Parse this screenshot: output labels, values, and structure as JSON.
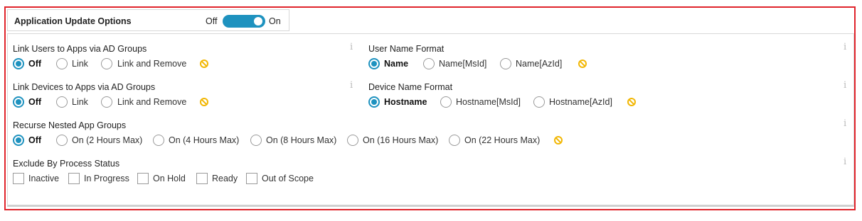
{
  "header": {
    "title": "Application Update Options",
    "toggle_off_label": "Off",
    "toggle_on_label": "On",
    "toggle_state": "on"
  },
  "sections": {
    "link_users": {
      "title": "Link Users to Apps via AD Groups",
      "options": [
        "Off",
        "Link",
        "Link and Remove"
      ],
      "selected": "Off"
    },
    "user_name_format": {
      "title": "User Name Format",
      "options": [
        "Name",
        "Name[MsId]",
        "Name[AzId]"
      ],
      "selected": "Name"
    },
    "link_devices": {
      "title": "Link Devices to Apps via AD Groups",
      "options": [
        "Off",
        "Link",
        "Link and Remove"
      ],
      "selected": "Off"
    },
    "device_name_format": {
      "title": "Device Name Format",
      "options": [
        "Hostname",
        "Hostname[MsId]",
        "Hostname[AzId]"
      ],
      "selected": "Hostname"
    },
    "recurse_nested": {
      "title": "Recurse Nested App Groups",
      "options": [
        "Off",
        "On (2 Hours Max)",
        "On (4 Hours Max)",
        "On (8 Hours Max)",
        "On (16 Hours Max)",
        "On (22 Hours Max)"
      ],
      "selected": "Off"
    },
    "exclude_status": {
      "title": "Exclude By Process Status",
      "options": [
        "Inactive",
        "In Progress",
        "On Hold",
        "Ready",
        "Out of Scope"
      ],
      "checked": []
    }
  },
  "colors": {
    "accent": "#1e92bf",
    "highlight_border": "#e0242b",
    "clear_icon": "#f2b705"
  },
  "icons": {
    "info": "info-icon",
    "clear": "clear-icon"
  }
}
